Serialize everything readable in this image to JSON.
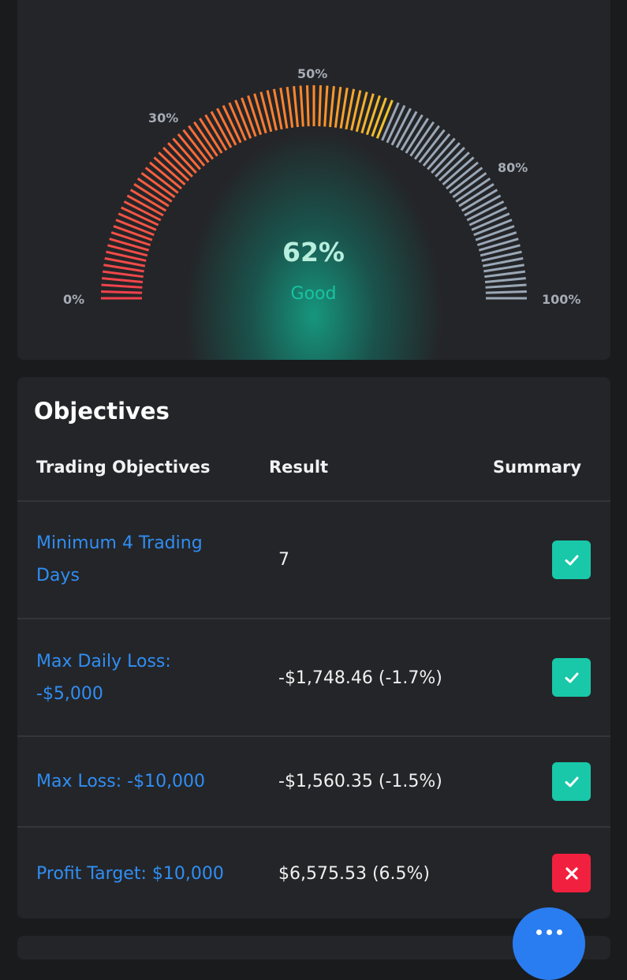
{
  "gauge": {
    "value": 62,
    "score_label": "62%",
    "rating_label": "Good",
    "scale_labels": [
      "0%",
      "30%",
      "50%",
      "80%",
      "100%"
    ],
    "colors": {
      "low": "#f0414d",
      "mid": "#ff8a2a",
      "high": "#f2c22c",
      "inactive": "#9aa7b6",
      "rating": "#19c3a3"
    }
  },
  "objectives": {
    "title": "Objectives",
    "columns": {
      "objective": "Trading Objectives",
      "result": "Result",
      "summary": "Summary"
    },
    "rows": [
      {
        "name": "Minimum 4 Trading Days",
        "result": "7",
        "status": "pass",
        "status_icon": "check-icon"
      },
      {
        "name": "Max Daily Loss: -$5,000",
        "result": "-$1,748.46 (-1.7%)",
        "status": "pass",
        "status_icon": "check-icon"
      },
      {
        "name": "Max Loss: -$10,000",
        "result": "-$1,560.35 (-1.5%)",
        "status": "pass",
        "status_icon": "check-icon"
      },
      {
        "name": "Profit Target: $10,000",
        "result": "$6,575.53 (6.5%)",
        "status": "fail",
        "status_icon": "close-icon"
      }
    ]
  },
  "chat_button": {
    "icon": "chat-dots-icon"
  }
}
